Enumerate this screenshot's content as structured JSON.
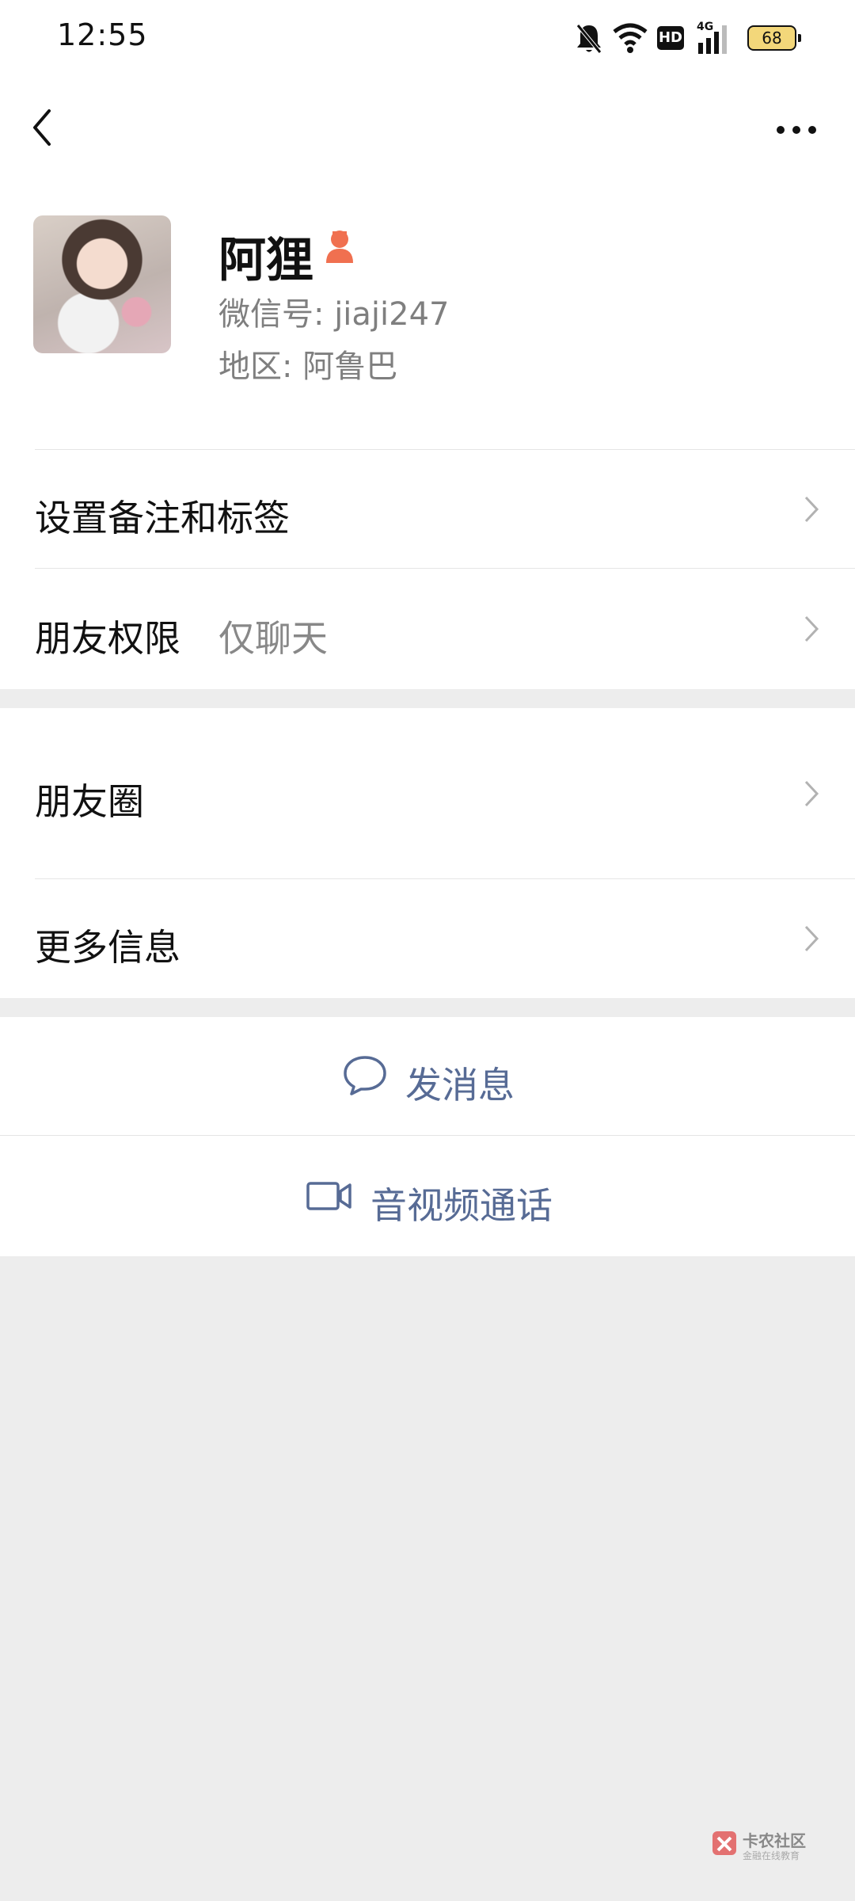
{
  "status_bar": {
    "time": "12:55",
    "battery": "68",
    "network": "4G",
    "hd_badge": "HD",
    "icons": [
      "bell-off-icon",
      "wifi-icon",
      "hd-icon",
      "signal-icon",
      "battery-icon"
    ]
  },
  "nav": {
    "back_icon": "chevron-left-icon",
    "more_icon": "more-horizontal-icon"
  },
  "profile": {
    "name": "阿狸",
    "gender_icon": "female-icon",
    "wechat_id": "微信号: jiaji247",
    "region": "地区: 阿鲁巴"
  },
  "rows": {
    "remark": {
      "label": "设置备注和标签"
    },
    "permission": {
      "label": "朋友权限",
      "value": "仅聊天"
    },
    "moments": {
      "label": "朋友圈"
    },
    "more_info": {
      "label": "更多信息"
    }
  },
  "actions": {
    "message": {
      "label": "发消息",
      "icon": "chat-bubble-icon"
    },
    "call": {
      "label": "音视频通话",
      "icon": "video-camera-icon"
    }
  },
  "watermark": {
    "text": "卡农社区",
    "subtext": "金融在线教育"
  },
  "colors": {
    "link_blue": "#576b95",
    "gender_orange": "#f07050",
    "background": "#ededed"
  }
}
